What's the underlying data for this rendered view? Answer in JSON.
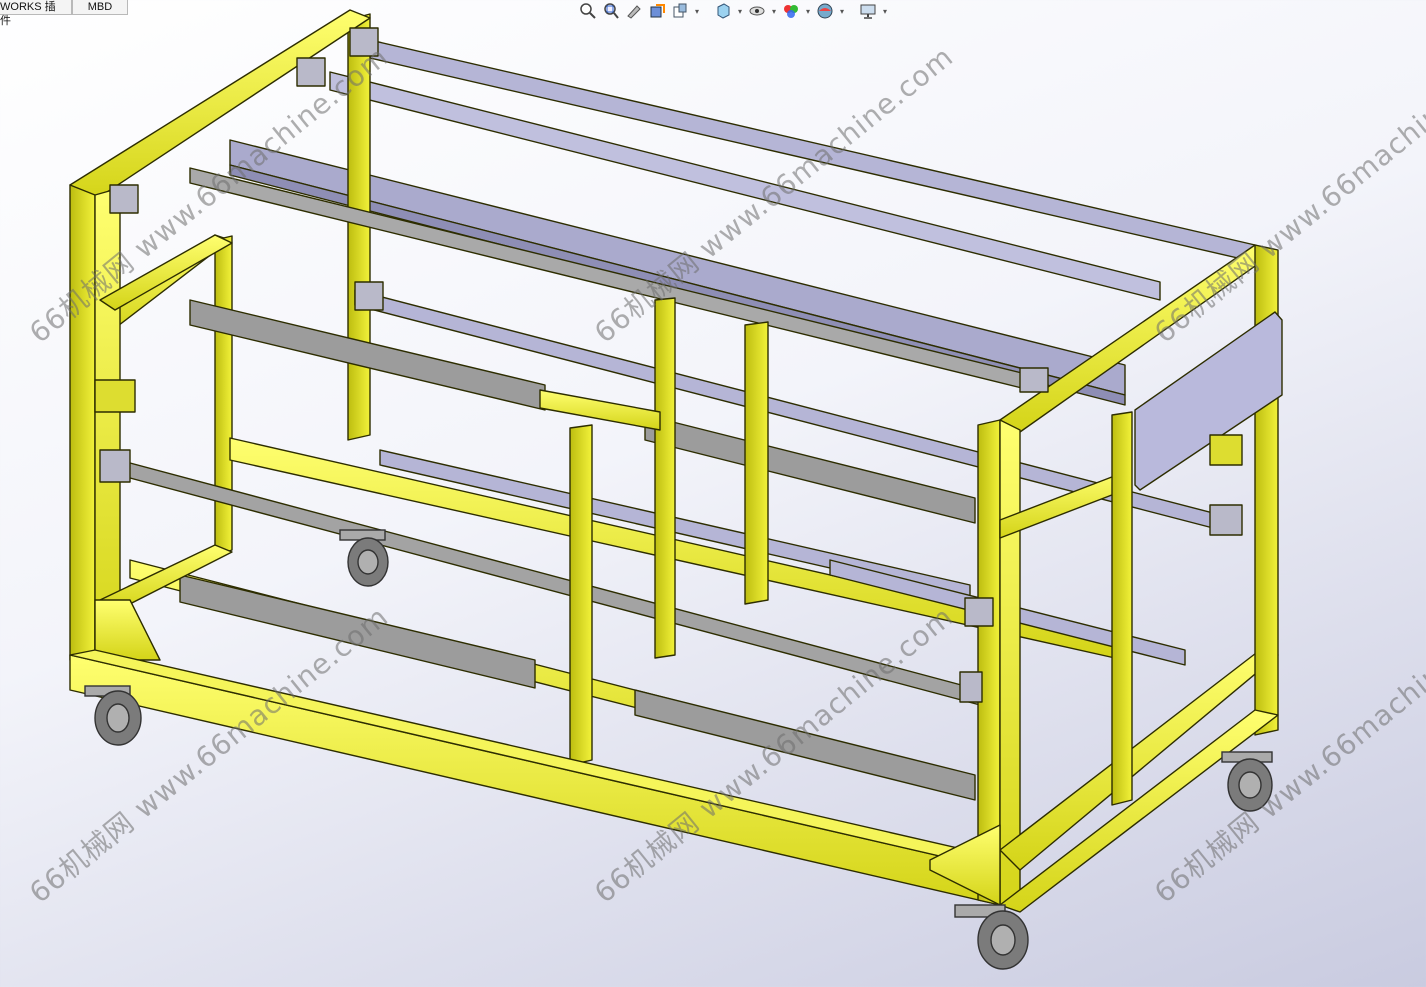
{
  "tabs": [
    {
      "label": "WORKS 插件"
    },
    {
      "label": "MBD"
    }
  ],
  "heads_up_toolbar": [
    {
      "icon": "zoom-to-fit-icon",
      "dropdown": false
    },
    {
      "icon": "zoom-to-area-icon",
      "dropdown": false
    },
    {
      "icon": "previous-view-icon",
      "dropdown": false
    },
    {
      "icon": "section-view-icon",
      "dropdown": false
    },
    {
      "icon": "dynamic-annotation-views-icon",
      "dropdown": true
    },
    {
      "icon": "view-orientation-icon",
      "dropdown": true
    },
    {
      "icon": "display-style-icon",
      "dropdown": true
    },
    {
      "icon": "hide-show-items-icon",
      "dropdown": true
    },
    {
      "icon": "edit-appearance-icon",
      "dropdown": true
    },
    {
      "icon": "apply-scene-icon",
      "dropdown": true
    },
    {
      "icon": "view-settings-icon",
      "dropdown": true
    }
  ],
  "model": {
    "description": "material rack cart assembly",
    "frame_color": "#e6e62e",
    "frame_edge_color": "#3a3a00",
    "rail_color": "#a8a8a8",
    "panel_color": "#b8b8d8",
    "wheel_color": "#8a8a8a"
  },
  "watermark": "66机械网 www.66machine.com"
}
